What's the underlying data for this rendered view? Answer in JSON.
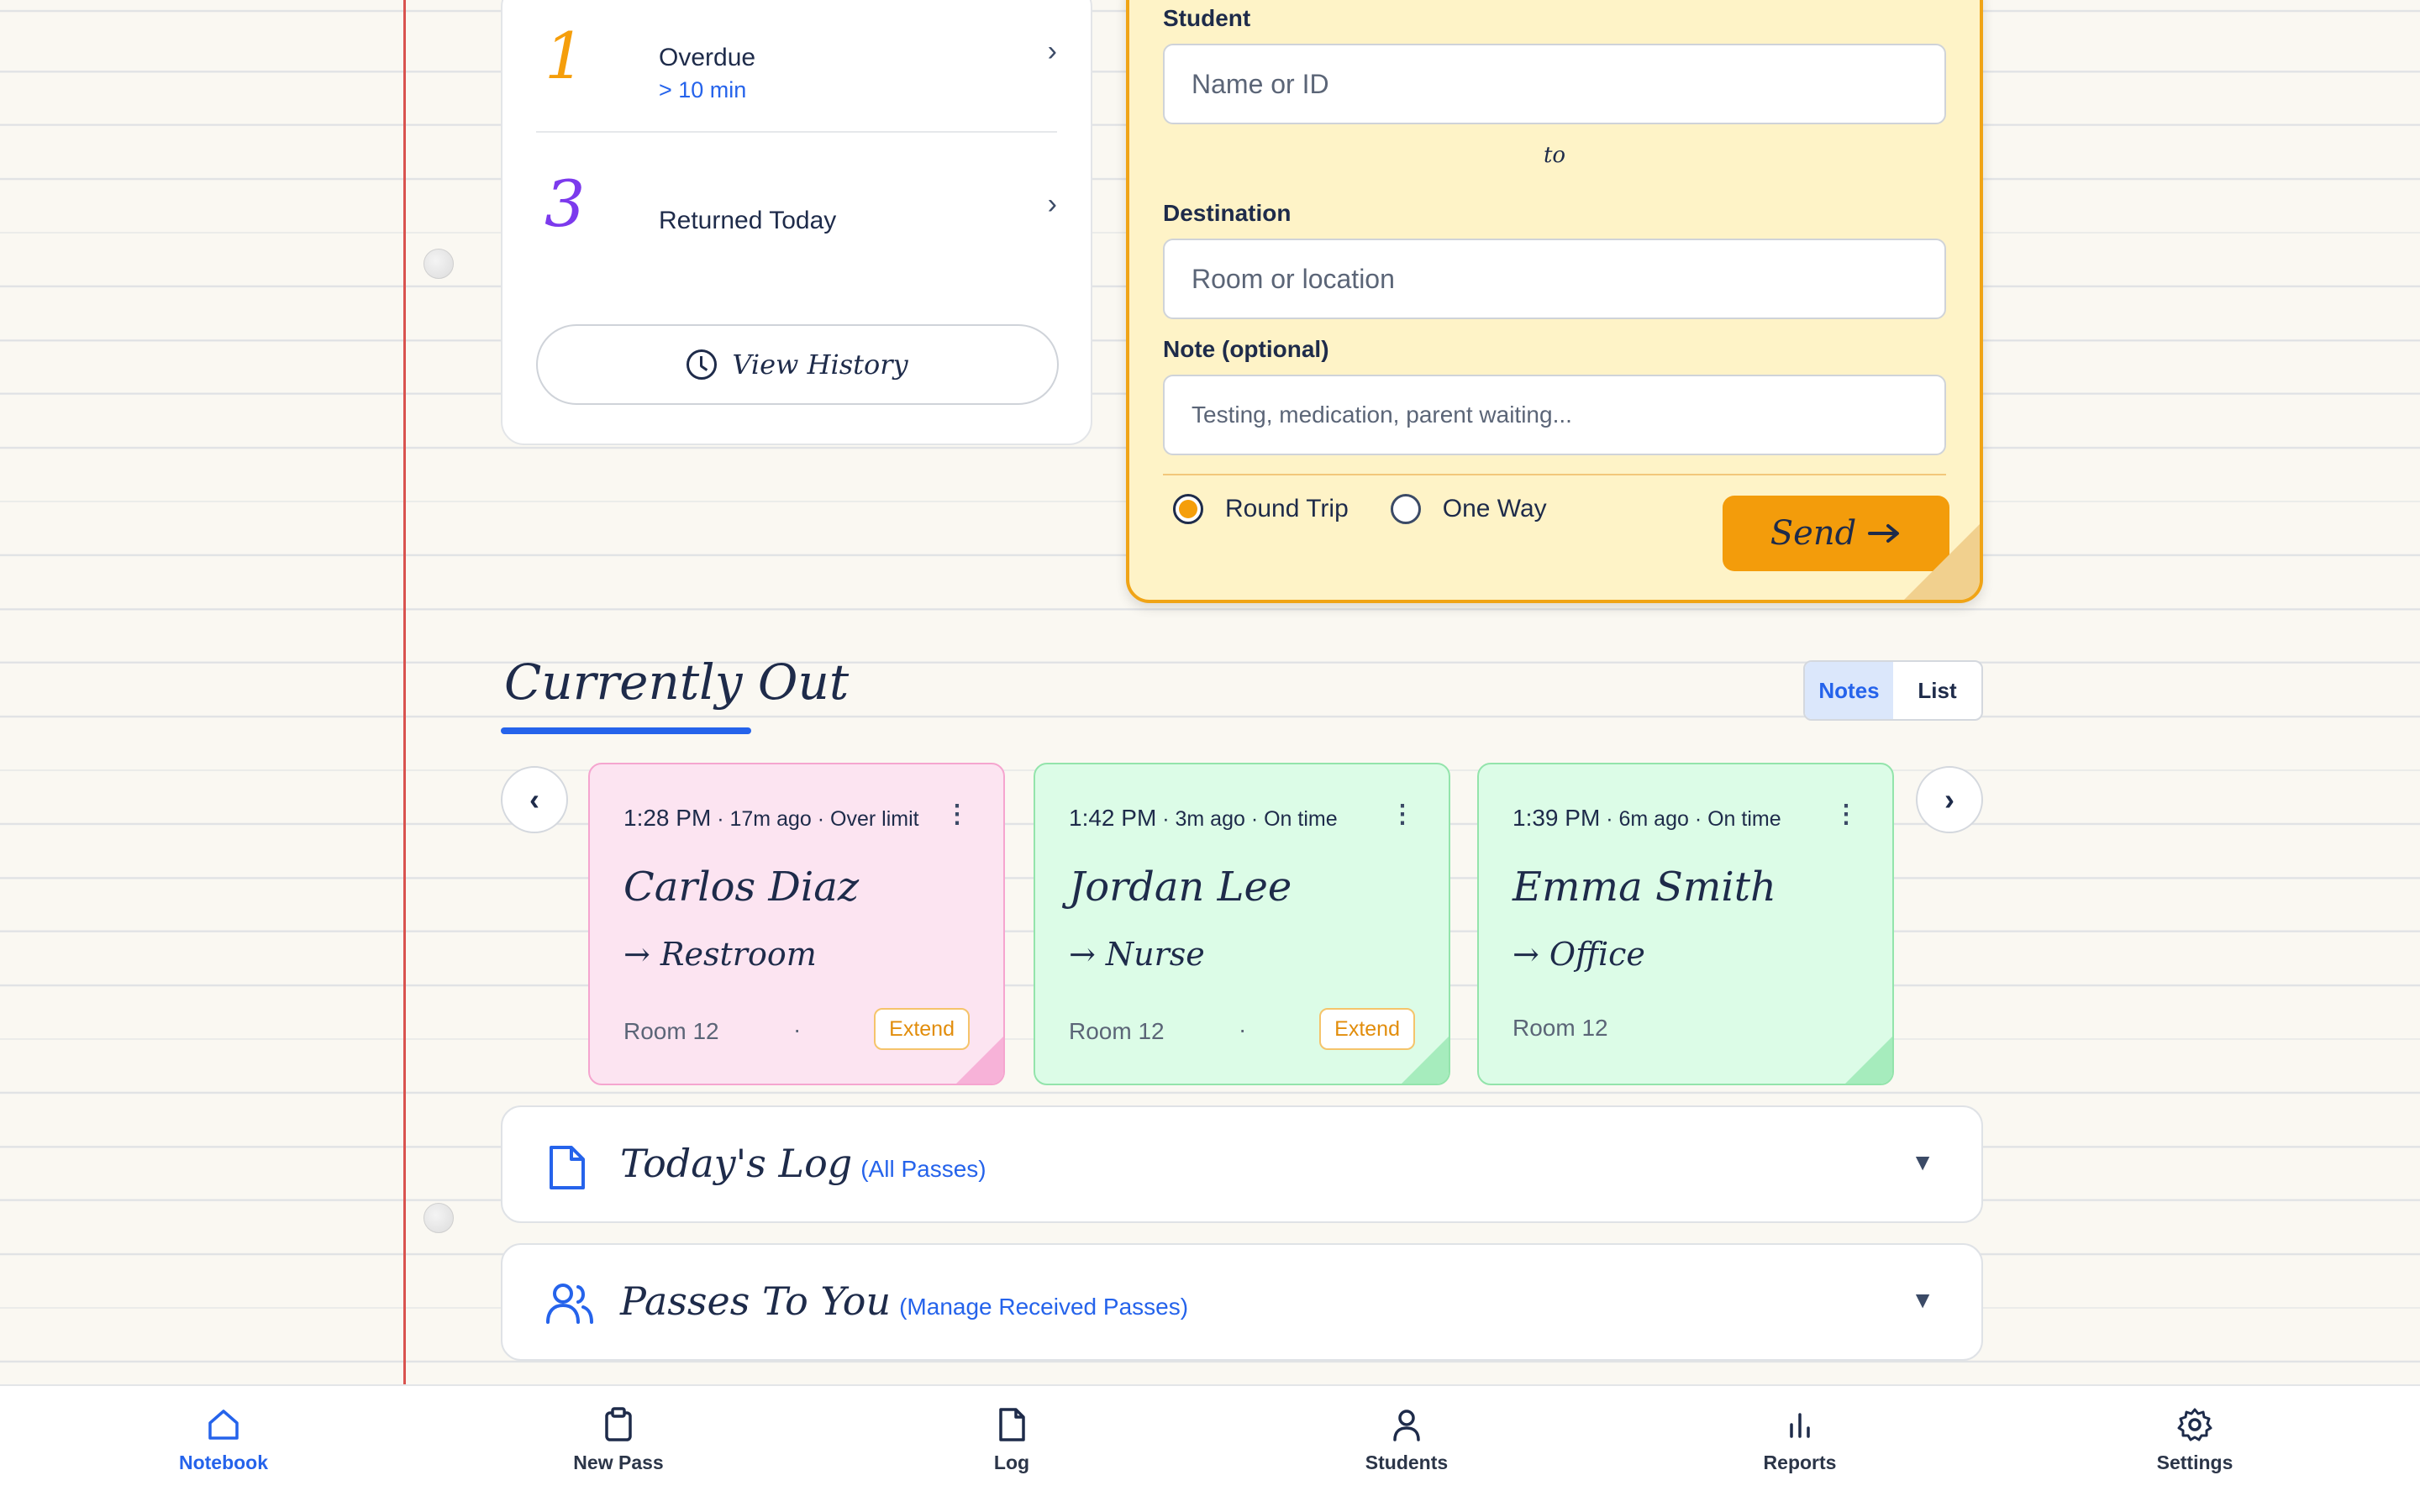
{
  "stats": {
    "overdue": {
      "count": "1",
      "label": "Overdue",
      "sub": "> 10 min"
    },
    "returned": {
      "count": "3",
      "label": "Returned Today"
    },
    "view_history": "View History"
  },
  "form": {
    "student_label": "Student",
    "student_placeholder": "Name or ID",
    "to_text": "to",
    "destination_label": "Destination",
    "destination_placeholder": "Room or location",
    "note_label": "Note (optional)",
    "note_placeholder": "Testing, medication, parent waiting...",
    "round_trip": "Round Trip",
    "one_way": "One Way",
    "selected_trip": "Round Trip",
    "send": "Send"
  },
  "currently_out": {
    "title": "Currently Out",
    "view_options": [
      "Notes",
      "List"
    ],
    "active_view": "Notes",
    "prev": "‹",
    "next": "›",
    "passes": [
      {
        "time": "1:28 PM",
        "ago": "17m ago",
        "status": "Over limit",
        "name": "Carlos Diaz",
        "destination": "Restroom",
        "room": "Room 12",
        "dot": "·",
        "extend": "Extend",
        "color": "pink"
      },
      {
        "time": "1:42 PM",
        "ago": "3m ago",
        "status": "On time",
        "name": "Jordan Lee",
        "destination": "Nurse",
        "room": "Room 12",
        "dot": "·",
        "extend": "Extend",
        "color": "green"
      },
      {
        "time": "1:39 PM",
        "ago": "6m ago",
        "status": "On time",
        "name": "Emma Smith",
        "destination": "Office",
        "room": "Room 12",
        "color": "green"
      }
    ]
  },
  "panels": {
    "log": {
      "title": "Today's Log",
      "sub": "(All Passes)"
    },
    "to_you": {
      "title": "Passes To You",
      "sub": "(Manage Received Passes)"
    }
  },
  "nav": [
    {
      "label": "Notebook",
      "icon": "home-icon",
      "active": true
    },
    {
      "label": "New Pass",
      "icon": "clipboard-icon"
    },
    {
      "label": "Log",
      "icon": "document-icon"
    },
    {
      "label": "Students",
      "icon": "user-icon"
    },
    {
      "label": "Reports",
      "icon": "bar-chart-icon"
    },
    {
      "label": "Settings",
      "icon": "gear-icon"
    }
  ],
  "colors": {
    "accent": "#2563eb",
    "send": "#f39c0b",
    "form_bg": "#fef3c7",
    "pink_note": "#fce4f1",
    "green_note": "#dcfce7",
    "overdue_num": "#f59e0b",
    "returned_num": "#7c3aed",
    "margin": "#d9534f"
  }
}
